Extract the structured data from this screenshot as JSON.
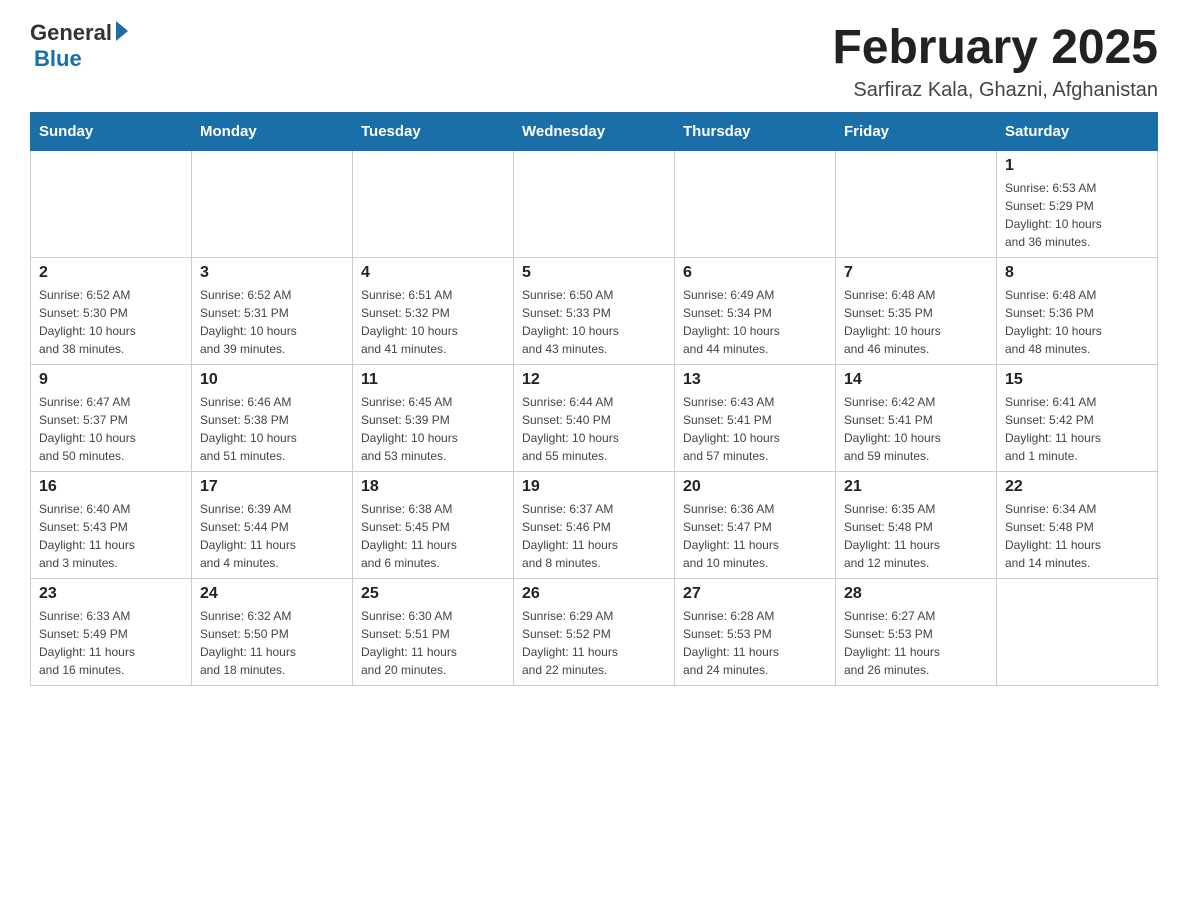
{
  "logo": {
    "general": "General",
    "blue": "Blue"
  },
  "title": "February 2025",
  "subtitle": "Sarfiraz Kala, Ghazni, Afghanistan",
  "days_of_week": [
    "Sunday",
    "Monday",
    "Tuesday",
    "Wednesday",
    "Thursday",
    "Friday",
    "Saturday"
  ],
  "weeks": [
    [
      {
        "day": "",
        "info": ""
      },
      {
        "day": "",
        "info": ""
      },
      {
        "day": "",
        "info": ""
      },
      {
        "day": "",
        "info": ""
      },
      {
        "day": "",
        "info": ""
      },
      {
        "day": "",
        "info": ""
      },
      {
        "day": "1",
        "info": "Sunrise: 6:53 AM\nSunset: 5:29 PM\nDaylight: 10 hours\nand 36 minutes."
      }
    ],
    [
      {
        "day": "2",
        "info": "Sunrise: 6:52 AM\nSunset: 5:30 PM\nDaylight: 10 hours\nand 38 minutes."
      },
      {
        "day": "3",
        "info": "Sunrise: 6:52 AM\nSunset: 5:31 PM\nDaylight: 10 hours\nand 39 minutes."
      },
      {
        "day": "4",
        "info": "Sunrise: 6:51 AM\nSunset: 5:32 PM\nDaylight: 10 hours\nand 41 minutes."
      },
      {
        "day": "5",
        "info": "Sunrise: 6:50 AM\nSunset: 5:33 PM\nDaylight: 10 hours\nand 43 minutes."
      },
      {
        "day": "6",
        "info": "Sunrise: 6:49 AM\nSunset: 5:34 PM\nDaylight: 10 hours\nand 44 minutes."
      },
      {
        "day": "7",
        "info": "Sunrise: 6:48 AM\nSunset: 5:35 PM\nDaylight: 10 hours\nand 46 minutes."
      },
      {
        "day": "8",
        "info": "Sunrise: 6:48 AM\nSunset: 5:36 PM\nDaylight: 10 hours\nand 48 minutes."
      }
    ],
    [
      {
        "day": "9",
        "info": "Sunrise: 6:47 AM\nSunset: 5:37 PM\nDaylight: 10 hours\nand 50 minutes."
      },
      {
        "day": "10",
        "info": "Sunrise: 6:46 AM\nSunset: 5:38 PM\nDaylight: 10 hours\nand 51 minutes."
      },
      {
        "day": "11",
        "info": "Sunrise: 6:45 AM\nSunset: 5:39 PM\nDaylight: 10 hours\nand 53 minutes."
      },
      {
        "day": "12",
        "info": "Sunrise: 6:44 AM\nSunset: 5:40 PM\nDaylight: 10 hours\nand 55 minutes."
      },
      {
        "day": "13",
        "info": "Sunrise: 6:43 AM\nSunset: 5:41 PM\nDaylight: 10 hours\nand 57 minutes."
      },
      {
        "day": "14",
        "info": "Sunrise: 6:42 AM\nSunset: 5:41 PM\nDaylight: 10 hours\nand 59 minutes."
      },
      {
        "day": "15",
        "info": "Sunrise: 6:41 AM\nSunset: 5:42 PM\nDaylight: 11 hours\nand 1 minute."
      }
    ],
    [
      {
        "day": "16",
        "info": "Sunrise: 6:40 AM\nSunset: 5:43 PM\nDaylight: 11 hours\nand 3 minutes."
      },
      {
        "day": "17",
        "info": "Sunrise: 6:39 AM\nSunset: 5:44 PM\nDaylight: 11 hours\nand 4 minutes."
      },
      {
        "day": "18",
        "info": "Sunrise: 6:38 AM\nSunset: 5:45 PM\nDaylight: 11 hours\nand 6 minutes."
      },
      {
        "day": "19",
        "info": "Sunrise: 6:37 AM\nSunset: 5:46 PM\nDaylight: 11 hours\nand 8 minutes."
      },
      {
        "day": "20",
        "info": "Sunrise: 6:36 AM\nSunset: 5:47 PM\nDaylight: 11 hours\nand 10 minutes."
      },
      {
        "day": "21",
        "info": "Sunrise: 6:35 AM\nSunset: 5:48 PM\nDaylight: 11 hours\nand 12 minutes."
      },
      {
        "day": "22",
        "info": "Sunrise: 6:34 AM\nSunset: 5:48 PM\nDaylight: 11 hours\nand 14 minutes."
      }
    ],
    [
      {
        "day": "23",
        "info": "Sunrise: 6:33 AM\nSunset: 5:49 PM\nDaylight: 11 hours\nand 16 minutes."
      },
      {
        "day": "24",
        "info": "Sunrise: 6:32 AM\nSunset: 5:50 PM\nDaylight: 11 hours\nand 18 minutes."
      },
      {
        "day": "25",
        "info": "Sunrise: 6:30 AM\nSunset: 5:51 PM\nDaylight: 11 hours\nand 20 minutes."
      },
      {
        "day": "26",
        "info": "Sunrise: 6:29 AM\nSunset: 5:52 PM\nDaylight: 11 hours\nand 22 minutes."
      },
      {
        "day": "27",
        "info": "Sunrise: 6:28 AM\nSunset: 5:53 PM\nDaylight: 11 hours\nand 24 minutes."
      },
      {
        "day": "28",
        "info": "Sunrise: 6:27 AM\nSunset: 5:53 PM\nDaylight: 11 hours\nand 26 minutes."
      },
      {
        "day": "",
        "info": ""
      }
    ]
  ]
}
